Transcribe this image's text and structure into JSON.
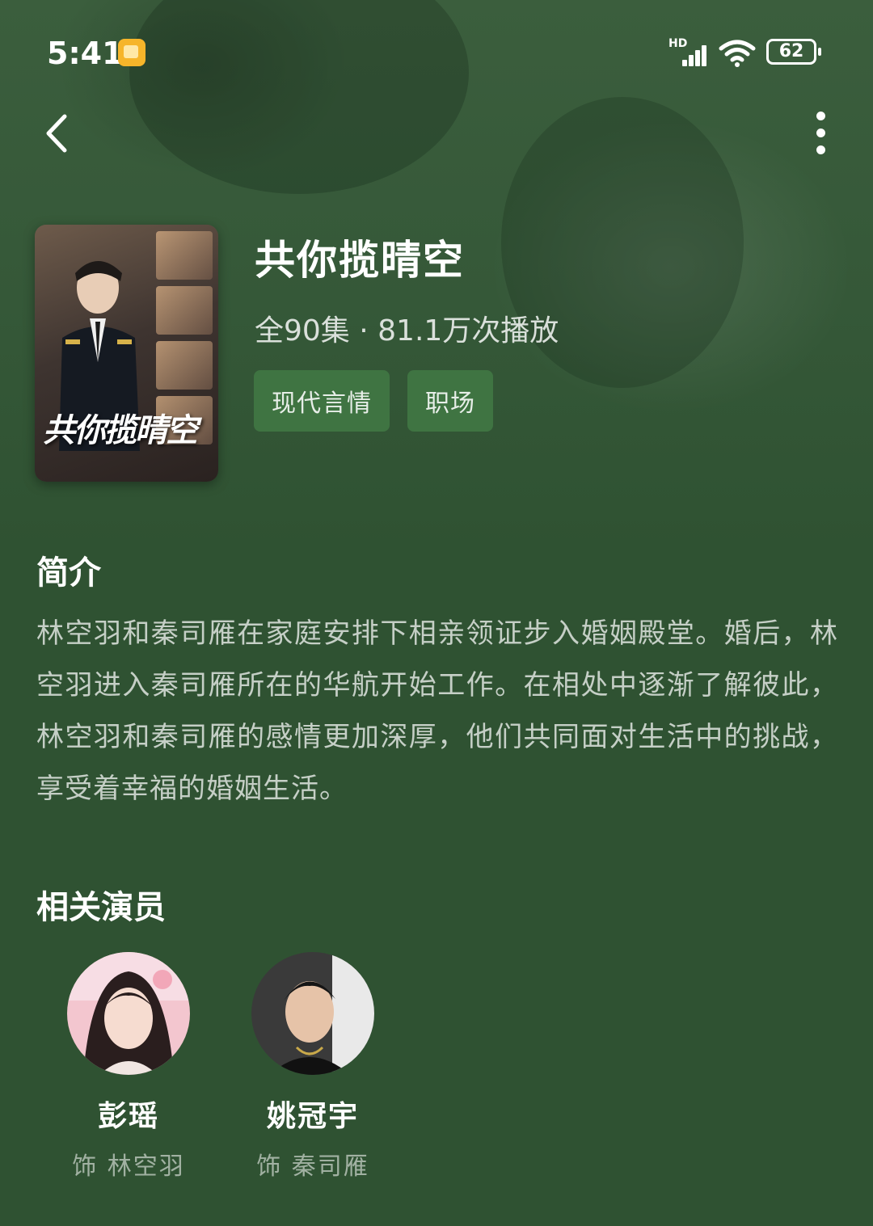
{
  "status_bar": {
    "time": "5:41",
    "network": "HD",
    "battery": "62"
  },
  "nav": {
    "back_icon": "chevron-left-icon",
    "more_icon": "more-vertical-icon"
  },
  "poster": {
    "title_art": "共你揽晴空"
  },
  "show": {
    "title": "共你揽晴空",
    "meta": "全90集 · 81.1万次播放",
    "tags": [
      "现代言情",
      "职场"
    ]
  },
  "synopsis": {
    "heading": "简介",
    "text": "林空羽和秦司雁在家庭安排下相亲领证步入婚姻殿堂。婚后，林空羽进入秦司雁所在的华航开始工作。在相处中逐渐了解彼此，林空羽和秦司雁的感情更加深厚，他们共同面对生活中的挑战，享受着幸福的婚姻生活。"
  },
  "cast": {
    "heading": "相关演员",
    "actors": [
      {
        "name": "彭瑶",
        "role": "饰 林空羽"
      },
      {
        "name": "姚冠宇",
        "role": "饰 秦司雁"
      }
    ]
  },
  "colors": {
    "background": "#2f5232",
    "tag_background": "#3f7442"
  }
}
